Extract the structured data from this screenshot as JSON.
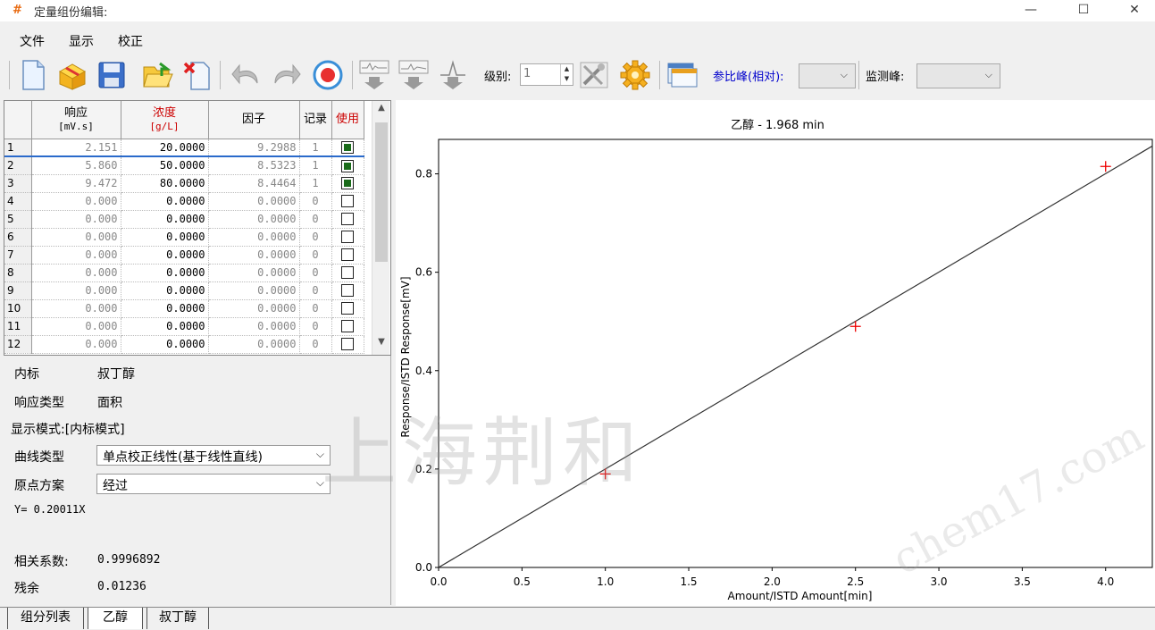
{
  "window": {
    "title": "定量组份编辑:",
    "minimize": "—",
    "maximize": "☐",
    "close": "✕"
  },
  "menu": [
    "文件",
    "显示",
    "校正"
  ],
  "toolbar": {
    "level_label": "级别:",
    "level_value": "1",
    "ref_peak_label": "参比峰(相对):",
    "ref_peak_value": "",
    "monitor_peak_label": "监测峰:",
    "monitor_peak_value": "",
    "colors": {
      "ref_peak_label": "#0000cc"
    }
  },
  "grid": {
    "columns": [
      {
        "label": "响应",
        "unit": "[mV.s]",
        "color": "#000000"
      },
      {
        "label": "浓度",
        "unit": "[g/L]",
        "color": "#cc0000"
      },
      {
        "label": "因子",
        "unit": "",
        "color": "#000000"
      },
      {
        "label": "记录",
        "unit": "",
        "color": "#000000"
      },
      {
        "label": "使用",
        "unit": "",
        "color": "#cc0000"
      }
    ],
    "rows": [
      {
        "n": "1",
        "resp": "2.151",
        "conc": "20.0000",
        "factor": "9.2988",
        "rec": "1",
        "use": true
      },
      {
        "n": "2",
        "resp": "5.860",
        "conc": "50.0000",
        "factor": "8.5323",
        "rec": "1",
        "use": true
      },
      {
        "n": "3",
        "resp": "9.472",
        "conc": "80.0000",
        "factor": "8.4464",
        "rec": "1",
        "use": true
      },
      {
        "n": "4",
        "resp": "0.000",
        "conc": "0.0000",
        "factor": "0.0000",
        "rec": "0",
        "use": false
      },
      {
        "n": "5",
        "resp": "0.000",
        "conc": "0.0000",
        "factor": "0.0000",
        "rec": "0",
        "use": false
      },
      {
        "n": "6",
        "resp": "0.000",
        "conc": "0.0000",
        "factor": "0.0000",
        "rec": "0",
        "use": false
      },
      {
        "n": "7",
        "resp": "0.000",
        "conc": "0.0000",
        "factor": "0.0000",
        "rec": "0",
        "use": false
      },
      {
        "n": "8",
        "resp": "0.000",
        "conc": "0.0000",
        "factor": "0.0000",
        "rec": "0",
        "use": false
      },
      {
        "n": "9",
        "resp": "0.000",
        "conc": "0.0000",
        "factor": "0.0000",
        "rec": "0",
        "use": false
      },
      {
        "n": "10",
        "resp": "0.000",
        "conc": "0.0000",
        "factor": "0.0000",
        "rec": "0",
        "use": false
      },
      {
        "n": "11",
        "resp": "0.000",
        "conc": "0.0000",
        "factor": "0.0000",
        "rec": "0",
        "use": false
      },
      {
        "n": "12",
        "resp": "0.000",
        "conc": "0.0000",
        "factor": "0.0000",
        "rec": "0",
        "use": false
      }
    ]
  },
  "props": {
    "istd_label": "内标",
    "istd_value": "叔丁醇",
    "resp_type_label": "响应类型",
    "resp_type_value": "面积",
    "display_mode": "显示模式:[内标模式]",
    "curve_type_label": "曲线类型",
    "curve_type_value": "单点校正线性(基于线性直线)",
    "origin_label": "原点方案",
    "origin_value": "经过",
    "equation": "Y= 0.20011X",
    "corr_label": "相关系数:",
    "corr_value": "0.9996892",
    "resid_label": "残余",
    "resid_value": "0.01236"
  },
  "tabs": [
    "组分列表",
    "乙醇",
    "叔丁醇"
  ],
  "watermark": {
    "main": "上海荆和",
    "url": "chem17.com"
  },
  "chart_data": {
    "type": "scatter",
    "title": "乙醇 - 1.968 min",
    "xlabel": "Amount/ISTD Amount[min]",
    "ylabel": "Response/ISTD Response[mV]",
    "xlim": [
      0,
      4.28
    ],
    "ylim": [
      0,
      0.87
    ],
    "xticks": [
      0.0,
      0.5,
      1.0,
      1.5,
      2.0,
      2.5,
      3.0,
      3.5,
      4.0
    ],
    "yticks": [
      0.0,
      0.2,
      0.4,
      0.6,
      0.8
    ],
    "points": [
      {
        "x": 1.0,
        "y": 0.19
      },
      {
        "x": 2.5,
        "y": 0.49
      },
      {
        "x": 4.0,
        "y": 0.815
      }
    ],
    "fit": {
      "slope": 0.20011,
      "intercept": 0
    },
    "marker_color": "#ee0000",
    "line_color": "#333333",
    "grid": false
  }
}
